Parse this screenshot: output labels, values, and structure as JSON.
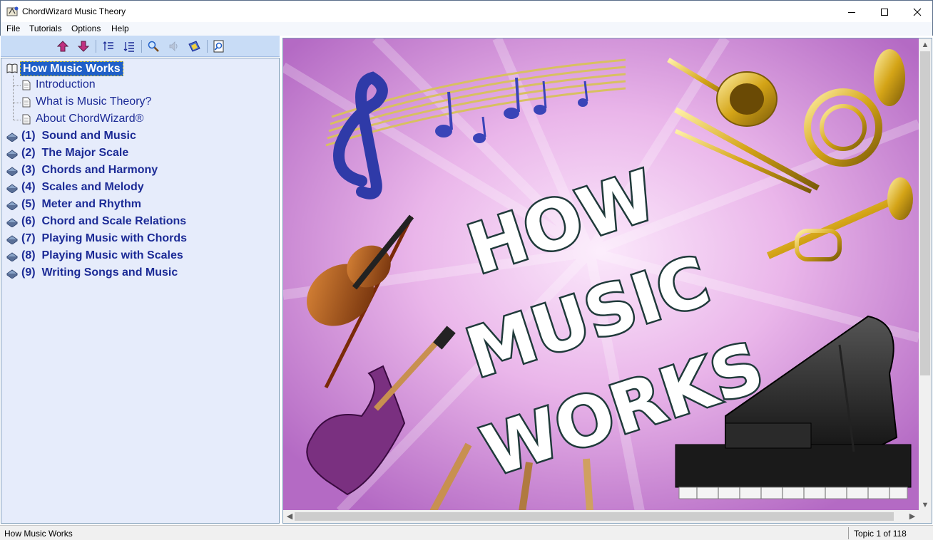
{
  "window": {
    "title": "ChordWizard Music Theory"
  },
  "menu": {
    "file": "File",
    "tutorials": "Tutorials",
    "options": "Options",
    "help": "Help"
  },
  "toolbar": {
    "icons": [
      "arrow-up-icon",
      "arrow-down-icon",
      "sort-ascending-icon",
      "sort-descending-icon",
      "search-icon",
      "speaker-icon",
      "bookmark-icon",
      "find-page-icon"
    ]
  },
  "tree": {
    "root": "How Music Works",
    "children": [
      "Introduction",
      "What is Music Theory?",
      "About ChordWizard®"
    ],
    "chapters": [
      "(1)  Sound and Music",
      "(2)  The Major Scale",
      "(3)  Chords and Harmony",
      "(4)  Scales and Melody",
      "(5)  Meter and Rhythm",
      "(6)  Chord and Scale Relations",
      "(7)  Playing Music with Chords",
      "(8)  Playing Music with Scales",
      "(9)  Writing Songs and Music"
    ]
  },
  "banner": {
    "line1": "HOW",
    "line2": "MUSIC",
    "line3": "WORKS"
  },
  "status": {
    "left": "How Music Works",
    "right": "Topic 1 of 118"
  },
  "colors": {
    "accent": "#1f5fc7",
    "tree_text": "#1c2b96",
    "tree_bg": "#e6ecfb",
    "toolbar_bg": "#c8dcf6"
  }
}
